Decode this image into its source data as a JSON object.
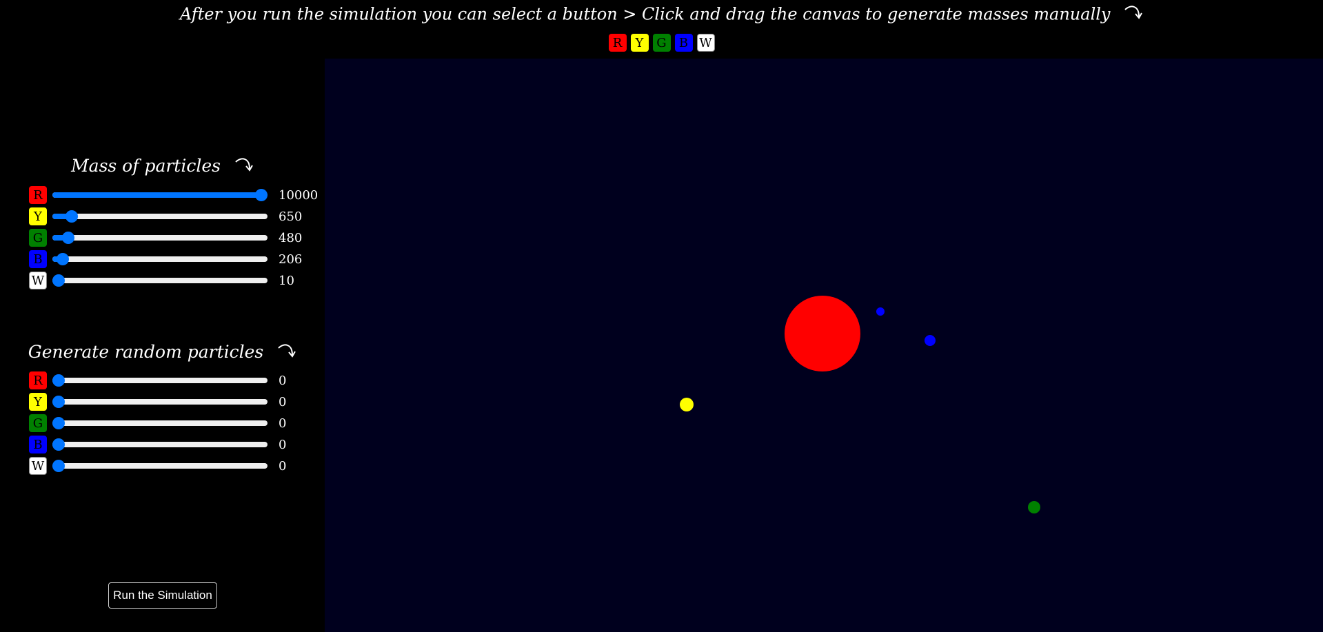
{
  "header": {
    "instruction": "After you run the simulation you can select a button > Click and drag the canvas to generate masses manually",
    "color_buttons": [
      {
        "label": "R",
        "bg": "#ff0000",
        "fg": "#000000"
      },
      {
        "label": "Y",
        "bg": "#ffff00",
        "fg": "#000000"
      },
      {
        "label": "G",
        "bg": "#008000",
        "fg": "#000000"
      },
      {
        "label": "B",
        "bg": "#0000ff",
        "fg": "#000000"
      },
      {
        "label": "W",
        "bg": "#ffffff",
        "fg": "#000000"
      }
    ]
  },
  "mass_section": {
    "title": "Mass of particles",
    "sliders": [
      {
        "label": "R",
        "value": "10000",
        "fraction": 1.0
      },
      {
        "label": "Y",
        "value": "650",
        "fraction": 0.065
      },
      {
        "label": "G",
        "value": "480",
        "fraction": 0.048
      },
      {
        "label": "B",
        "value": "206",
        "fraction": 0.02
      },
      {
        "label": "W",
        "value": "10",
        "fraction": 0.0
      }
    ]
  },
  "random_section": {
    "title": "Generate random particles",
    "sliders": [
      {
        "label": "R",
        "value": "0",
        "fraction": 0.0
      },
      {
        "label": "Y",
        "value": "0",
        "fraction": 0.0
      },
      {
        "label": "G",
        "value": "0",
        "fraction": 0.0
      },
      {
        "label": "B",
        "value": "0",
        "fraction": 0.0
      },
      {
        "label": "W",
        "value": "0",
        "fraction": 0.0
      }
    ]
  },
  "run_button": "Run the Simulation",
  "canvas": {
    "background": "#00001e",
    "particles": [
      {
        "color": "#ff0000"
      },
      {
        "color": "#0000ff"
      },
      {
        "color": "#0000ff"
      },
      {
        "color": "#ffff00"
      },
      {
        "color": "#008000"
      }
    ]
  },
  "colors": {
    "slider_accent": "#0075ff",
    "track": "#efefef"
  }
}
